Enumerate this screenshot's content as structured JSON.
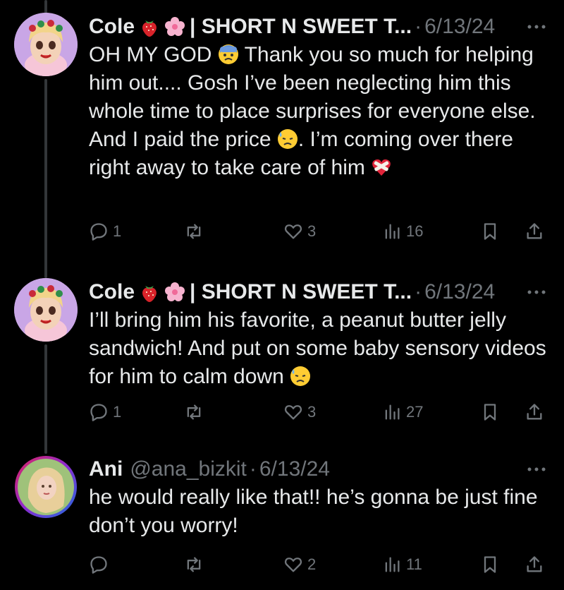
{
  "tweets": [
    {
      "name": "Cole",
      "affix": "| SHORT N SWEET T...",
      "handle": "",
      "dot": "·",
      "date": "6/13/24",
      "text_parts": [
        "OH MY GOD ",
        " Thank you so much for helping him out.... Gosh I’ve been neglecting him this whole time to place surprises for everyone else. And I paid the price ",
        ". I’m coming over there right away to take care of him "
      ],
      "icons": [
        "strawberry-emoji-icon",
        "cherry-blossom-emoji-icon",
        "fearful-face-emoji-icon",
        "downcast-sweat-emoji-icon",
        "mending-heart-emoji-icon"
      ],
      "replies": "1",
      "reposts": "",
      "likes": "3",
      "views": "16"
    },
    {
      "name": "Cole",
      "affix": "| SHORT N SWEET T...",
      "handle": "",
      "dot": "·",
      "date": "6/13/24",
      "text_parts": [
        "I’ll bring him his favorite, a peanut butter jelly sandwich! And put on some baby sensory videos for him to calm down "
      ],
      "icons": [
        "strawberry-emoji-icon",
        "cherry-blossom-emoji-icon",
        "downcast-sweat-emoji-icon"
      ],
      "replies": "1",
      "reposts": "",
      "likes": "3",
      "views": "27"
    },
    {
      "name": "Ani",
      "affix": "",
      "handle": "@ana_bizkit",
      "dot": "·",
      "date": "6/13/24",
      "text_parts": [
        "he would really like that!! he’s gonna be just fine don’t you worry!"
      ],
      "icons": [],
      "replies": "",
      "reposts": "",
      "likes": "2",
      "views": "11"
    }
  ],
  "colors": {
    "background": "#000000",
    "text": "#e7e9ea",
    "muted": "#71767b",
    "thread_line": "#333639"
  }
}
